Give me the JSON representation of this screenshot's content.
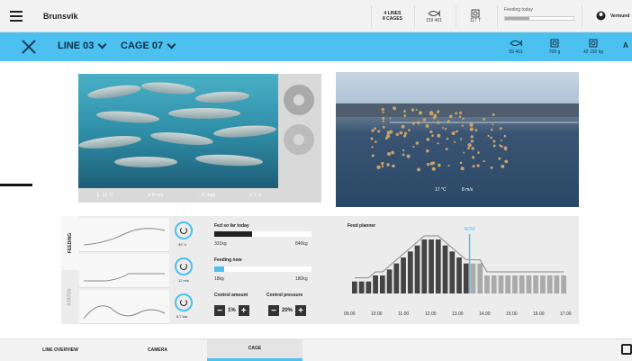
{
  "header": {
    "site": "Brunsvik",
    "lines": "4 LINES",
    "cages": "8 CAGES",
    "fish_count": "159 461",
    "feed_total": "117 T",
    "feeding_today_label": "Feeding today",
    "feeding_today_progress": 0.35,
    "user": "Vermund"
  },
  "nav": {
    "line": "LINE 03",
    "cage": "CAGE 07",
    "fish_count": "59 461",
    "fish_weight": "709 g",
    "biomass": "42 192 kg",
    "extra": "A"
  },
  "camera_left": {
    "temp": "12 °C",
    "current": "8 m/s",
    "oxygen": "11 mg/l",
    "depth": "7 m"
  },
  "camera_right": {
    "temp": "17 °C",
    "wind": "8 m/s"
  },
  "tabs": {
    "feeding": "FEEDING",
    "status": "STATUS"
  },
  "mini_charts": [
    {
      "value": "49 °c"
    },
    {
      "value": "12 m/s"
    },
    {
      "value": "8.7 bar"
    }
  ],
  "feed": {
    "fed_so_far_label": "Fed so far today",
    "fed_so_far_value": "331kg",
    "fed_so_far_max": "840kg",
    "fed_so_far_progress": 0.39,
    "feeding_now_label": "Feeding now",
    "feeding_now_value": "18kg",
    "feeding_now_max": "180kg",
    "feeding_now_progress": 0.1,
    "control_amount_label": "Control amount",
    "control_amount_value": "1%",
    "control_pressure_label": "Control pressure",
    "control_pressure_value": "20%"
  },
  "planner": {
    "title": "Feed planner",
    "now_label": "NOW",
    "times": [
      "09.00",
      "10.00",
      "11.00",
      "12.00",
      "13.00",
      "14.00",
      "15.00",
      "16.00",
      "17.00"
    ],
    "bars": [
      2,
      2,
      2,
      3,
      3,
      4,
      5,
      6,
      7,
      8,
      9,
      9,
      9,
      8,
      7,
      6,
      5,
      5,
      5,
      3,
      3,
      3,
      3,
      3,
      3,
      3,
      3,
      3,
      3,
      3,
      3
    ],
    "now_index": 17
  },
  "bottom_tabs": [
    "LINE OVERVIEW",
    "CAMERA",
    "CAGE"
  ],
  "colors": {
    "accent": "#4cc0ee",
    "nav_text": "#13324a"
  }
}
